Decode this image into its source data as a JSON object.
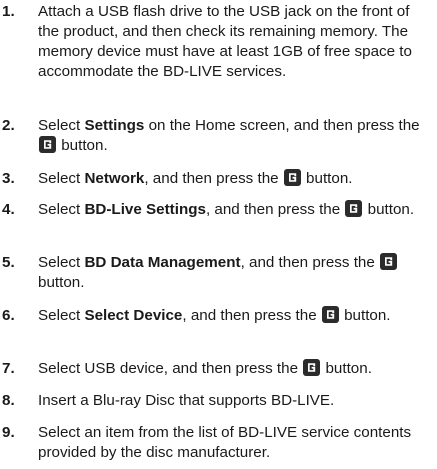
{
  "steps": [
    {
      "num": "1.",
      "text": "Attach a USB flash drive to the USB jack on the front of the product, and then check its remaining memory. The memory device must have at least 1GB of free space to accommodate the BD-LIVE services."
    },
    {
      "num": "2.",
      "pre": "Select ",
      "bold": "Settings",
      "post": " on the Home screen, and then press the ",
      "tail": " button."
    },
    {
      "num": "3.",
      "pre": "Select ",
      "bold": "Network",
      "post": ", and then press the ",
      "tail": " button."
    },
    {
      "num": "4.",
      "pre": "Select ",
      "bold": "BD-Live Settings",
      "post": ", and then press the ",
      "tail": " button."
    },
    {
      "num": "5.",
      "pre": "Select ",
      "bold": "BD Data Management",
      "post": ", and then press the ",
      "tail": " button."
    },
    {
      "num": "6.",
      "pre": "Select ",
      "bold": "Select Device",
      "post": ", and then press the ",
      "tail": " button."
    },
    {
      "num": "7.",
      "pre": "Select USB device, and then press the ",
      "tail": " button."
    },
    {
      "num": "8.",
      "text": "Insert a Blu-ray Disc that supports BD-LIVE."
    },
    {
      "num": "9.",
      "text": "Select an item from the list of BD-LIVE service contents provided by the disc manufacturer."
    }
  ],
  "icons": {
    "enter_button": "enter-button-icon",
    "icon_color": "#2b2b2b"
  }
}
